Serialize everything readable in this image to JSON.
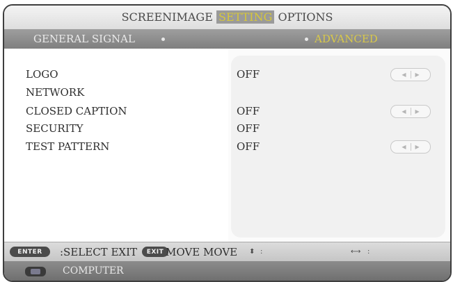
{
  "menu": {
    "tabs": [
      {
        "label": "SCREEN",
        "active": false
      },
      {
        "label": "IMAGE",
        "active": false
      },
      {
        "label": "SETTING",
        "active": true
      },
      {
        "label": "OPTIONS",
        "active": false
      }
    ],
    "subtabs": [
      {
        "label": "GENERAL SIGNAL",
        "active": false
      },
      {
        "label": "ADVANCED",
        "active": true
      }
    ]
  },
  "settings": [
    {
      "label": "LOGO",
      "value": "OFF",
      "has_stepper": true
    },
    {
      "label": "NETWORK",
      "value": "",
      "has_stepper": false
    },
    {
      "label": "CLOSED CAPTION",
      "value": "OFF",
      "has_stepper": true
    },
    {
      "label": "SECURITY",
      "value": "OFF",
      "has_stepper": false
    },
    {
      "label": "TEST PATTERN",
      "value": "OFF",
      "has_stepper": true
    }
  ],
  "stepper": {
    "left_glyph": "◀",
    "right_glyph": "▶"
  },
  "footer": {
    "enter_key": "ENTER",
    "exit_key": "EXIT",
    "select_text": ":SELECT EXIT",
    "move_text": "MOVE MOVE",
    "updown_glyph": "⬍",
    "leftright_glyph": "⟷",
    "colon": ":"
  },
  "source": {
    "label": "COMPUTER",
    "icon": "computer-icon"
  },
  "colors": {
    "accent": "#d7c73a",
    "bar": "#8a8a8a",
    "panel": "#f1f1f1"
  }
}
